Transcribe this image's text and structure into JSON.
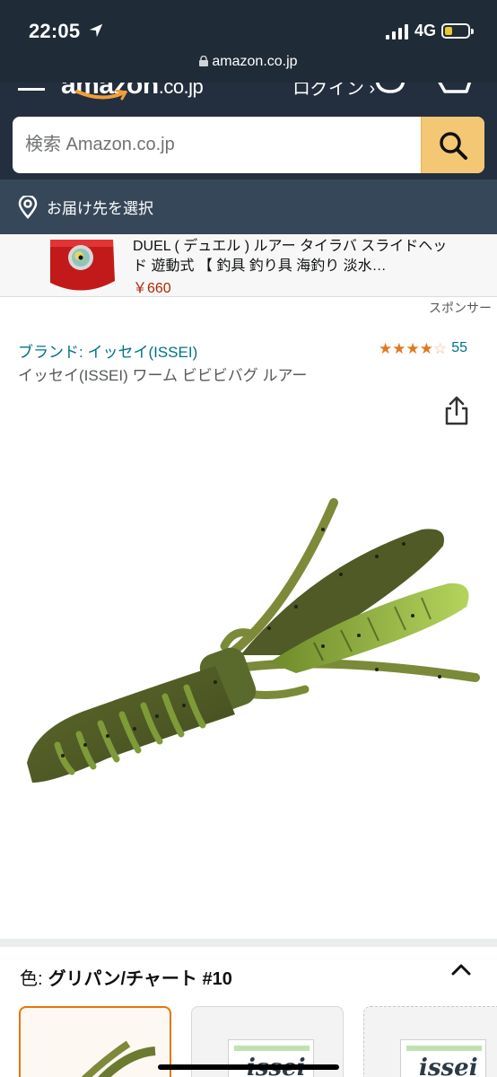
{
  "status_bar": {
    "time": "22:05",
    "network": "4G",
    "url": "amazon.co.jp",
    "battery_level": 0.35
  },
  "header": {
    "logo": "amazon",
    "logo_tld": ".co.jp",
    "signin_label": "ログイン ›",
    "search": {
      "placeholder": "検索 Amazon.co.jp",
      "value": ""
    }
  },
  "delivery": {
    "label": "お届け先を選択"
  },
  "sponsored_ad": {
    "title": "DUEL ( デュエル ) ルアー タイラバ スライドヘッド 遊動式 【 釣具 釣り具 海釣り 淡水…",
    "price": "￥660",
    "sponsor_label": "スポンサー"
  },
  "product": {
    "brand_link": "ブランド: イッセイ(ISSEI)",
    "rating": 4.5,
    "stars": [
      "full",
      "full",
      "full",
      "full",
      "empty"
    ],
    "review_count": "55",
    "title": "イッセイ(ISSEI) ワーム ビビビバグ ルアー"
  },
  "color_selector": {
    "label": "色:",
    "selected": "グリパン/チャート #10",
    "swatch_brand": "issei"
  },
  "colors": {
    "accent": "#e77600",
    "link": "#007185",
    "header_bg": "#232f3e",
    "search_button": "#f3c774",
    "price": "#b12704",
    "stars": "#de7921"
  }
}
